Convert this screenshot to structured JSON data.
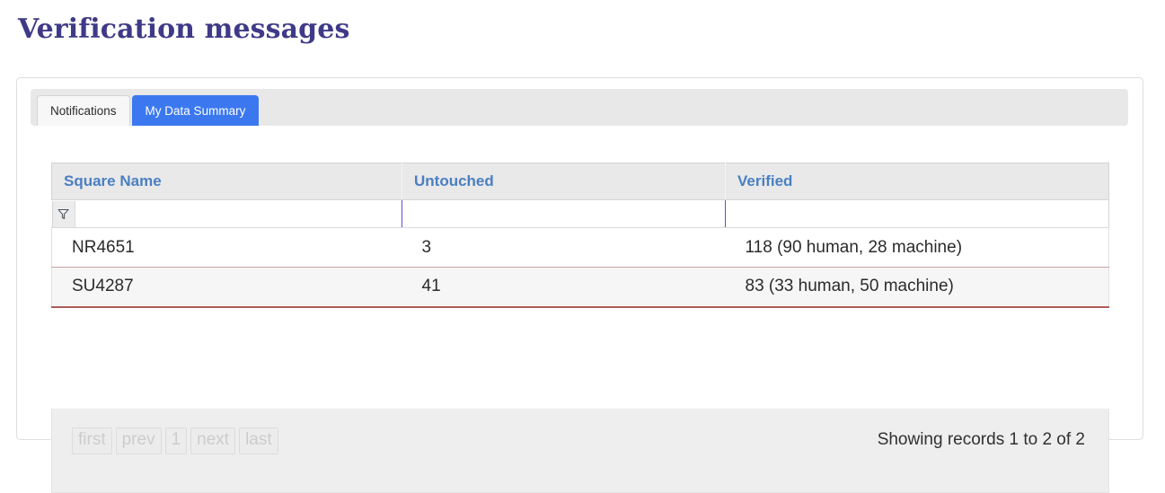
{
  "page": {
    "title": "Verification messages",
    "title_color": "#3f3a87"
  },
  "tabs": [
    {
      "label": "Notifications",
      "active": false,
      "name": "tab-notifications"
    },
    {
      "label": "My Data Summary",
      "active": true,
      "name": "tab-my-data-summary"
    }
  ],
  "tab_colors": {
    "active_bg": "#3b78f0",
    "active_text": "#ffffff",
    "inactive_bg": "#f7f7f7",
    "strip_bg": "#e8e8e8"
  },
  "table": {
    "columns": [
      {
        "label": "Square Name",
        "name": "column-square-name"
      },
      {
        "label": "Untouched",
        "name": "column-untouched"
      },
      {
        "label": "Verified",
        "name": "column-verified"
      }
    ],
    "header_color": "#4a7fc1",
    "filters": {
      "icon": "funnel-icon",
      "square_name_value": "",
      "untouched_value": "",
      "verified_value": "",
      "placeholder": ""
    },
    "rows": [
      {
        "square_name": "NR4651",
        "untouched": "3",
        "verified": "118 (90 human, 28 machine)"
      },
      {
        "square_name": "SU4287",
        "untouched": "41",
        "verified": "83 (33 human, 50 machine)"
      }
    ]
  },
  "pagination": {
    "first_label": "first",
    "prev_label": "prev",
    "page_label": "1",
    "next_label": "next",
    "last_label": "last",
    "status": "Showing records 1 to 2 of 2"
  }
}
